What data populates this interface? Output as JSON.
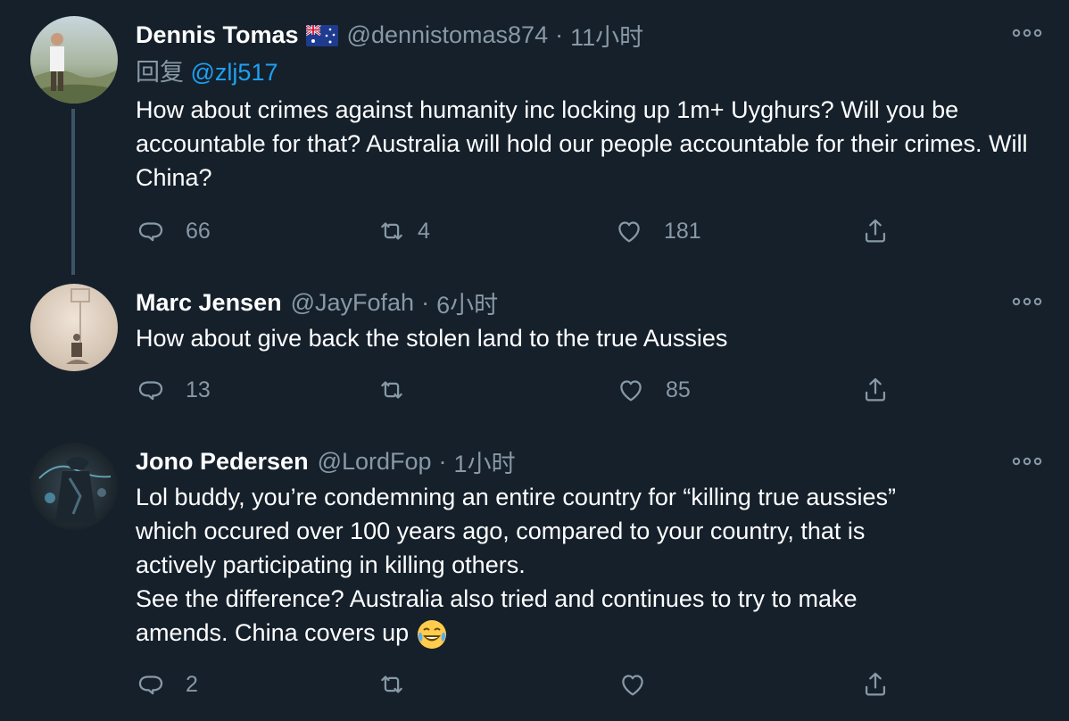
{
  "tweets": [
    {
      "name": "Dennis Tomas",
      "handle": "@dennistomas874",
      "separator": "·",
      "time": "11小时",
      "reply_label": "回复",
      "reply_mention": "@zlj517",
      "text": "How about crimes against humanity inc locking up 1m+ Uyghurs? Will you be accountable for that? Australia will hold our people accountable for their crimes. Will China?",
      "replies": "66",
      "retweets": "4",
      "likes": "181"
    },
    {
      "name": "Marc Jensen",
      "handle": "@JayFofah",
      "separator": "·",
      "time": "6小时",
      "text": "How about give back the stolen land to the true Aussies",
      "replies": "13",
      "retweets": "",
      "likes": "85"
    },
    {
      "name": "Jono Pedersen",
      "handle": "@LordFop",
      "separator": "·",
      "time": "1小时",
      "text_lines": [
        "Lol buddy, you’re condemning an entire country for “killing true aussies”",
        "which occured over 100 years ago, compared to your country, that is",
        "actively participating in killing others.",
        "See the difference? Australia also tried and continues to try to make",
        "amends. China covers up"
      ],
      "replies": "2",
      "retweets": "",
      "likes": ""
    }
  ],
  "colors": {
    "background": "#15202b",
    "secondary_text": "#8899a6",
    "link": "#1da1f2",
    "thread_line": "#3d5466"
  },
  "icons": [
    "reply-icon",
    "retweet-icon",
    "like-icon",
    "share-icon",
    "more-icon",
    "australia-flag-icon",
    "laughing-emoji-icon"
  ]
}
